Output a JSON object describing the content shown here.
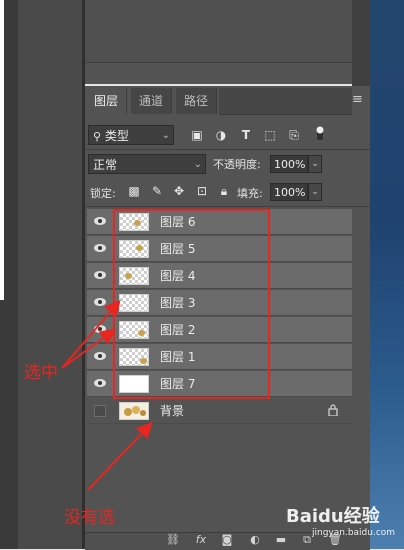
{
  "tabs": [
    {
      "label": "图层"
    },
    {
      "label": "通道"
    },
    {
      "label": "路径"
    }
  ],
  "filter": {
    "kind_label": "类型"
  },
  "blend": {
    "mode": "正常",
    "opacity_label": "不透明度:",
    "opacity_value": "100%"
  },
  "lockrow": {
    "lock_label": "锁定:",
    "fill_label": "填充:",
    "fill_value": "100%"
  },
  "layers": [
    {
      "name": "图层 6",
      "visible": true
    },
    {
      "name": "图层 5",
      "visible": true
    },
    {
      "name": "图层 4",
      "visible": true
    },
    {
      "name": "图层 3",
      "visible": true
    },
    {
      "name": "图层 2",
      "visible": true
    },
    {
      "name": "图层 1",
      "visible": true
    },
    {
      "name": "图层 7",
      "visible": true
    },
    {
      "name": "背景",
      "visible": false,
      "locked": true
    }
  ],
  "annotations": {
    "selected": "选中",
    "not_selected": "没有选"
  },
  "watermark": {
    "brand": "Baidu经验",
    "url": "jingyan.baidu.com"
  },
  "colors": {
    "annotation": "#e8251f",
    "panel_bg": "#535353",
    "row_bg": "#6b6b6b"
  }
}
